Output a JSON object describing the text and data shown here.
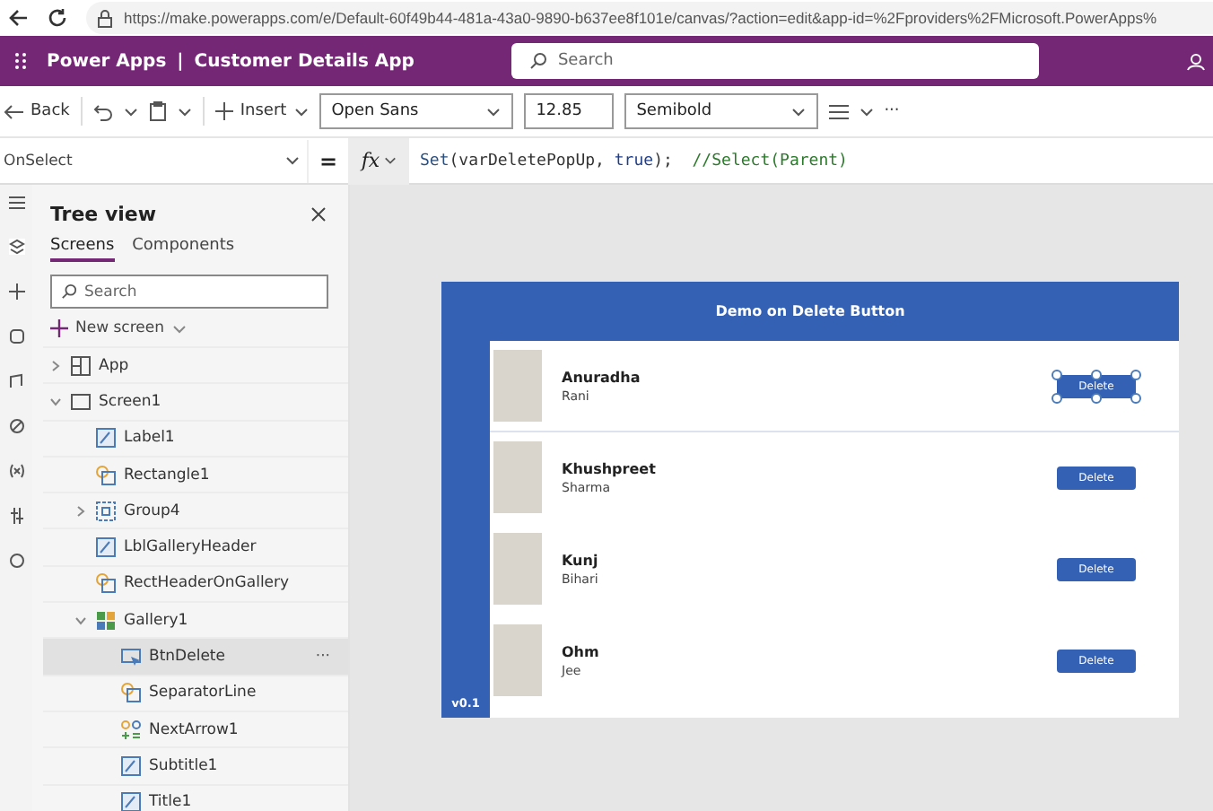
{
  "browser": {
    "url": "https://make.powerapps.com/e/Default-60f49b44-481a-43a0-9890-b637ee8f101e/canvas/?action=edit&app-id=%2Fproviders%2FMicrosoft.PowerApps%"
  },
  "header": {
    "product": "Power Apps",
    "separator": "|",
    "app_name": "Customer Details App",
    "search_placeholder": "Search"
  },
  "toolbar": {
    "back": "Back",
    "insert": "Insert",
    "font": "Open Sans",
    "font_size": "12.85",
    "font_weight": "Semibold",
    "more": "···"
  },
  "formula_bar": {
    "property": "OnSelect",
    "equals": "=",
    "fx": "fx",
    "code": [
      {
        "text": "Set",
        "kind": "fn"
      },
      {
        "text": "(varDeletePopUp, ",
        "kind": "plain"
      },
      {
        "text": "true",
        "kind": "keyword"
      },
      {
        "text": ");  ",
        "kind": "plain"
      },
      {
        "text": "//Select(Parent)",
        "kind": "comment"
      }
    ]
  },
  "tree_view": {
    "title": "Tree view",
    "tabs": [
      {
        "label": "Screens",
        "selected": true
      },
      {
        "label": "Components",
        "selected": false
      }
    ],
    "search_placeholder": "Search",
    "new_screen": "New screen",
    "items": [
      {
        "label": "App",
        "kind": "app",
        "expanded": false,
        "selected": false
      },
      {
        "label": "Screen1",
        "kind": "screen",
        "expanded": true,
        "selected": false,
        "children": [
          {
            "label": "Label1",
            "kind": "label",
            "selected": false
          },
          {
            "label": "Rectangle1",
            "kind": "shape",
            "selected": false
          },
          {
            "label": "Group4",
            "kind": "group",
            "expanded": false,
            "selected": false
          },
          {
            "label": "LblGalleryHeader",
            "kind": "label",
            "selected": false
          },
          {
            "label": "RectHeaderOnGallery",
            "kind": "shape",
            "selected": false
          },
          {
            "label": "Gallery1",
            "kind": "gallery",
            "expanded": true,
            "selected": false,
            "children": [
              {
                "label": "BtnDelete",
                "kind": "button",
                "selected": true,
                "more": "···"
              },
              {
                "label": "SeparatorLine",
                "kind": "shape",
                "selected": false
              },
              {
                "label": "NextArrow1",
                "kind": "icon",
                "selected": false
              },
              {
                "label": "Subtitle1",
                "kind": "label",
                "selected": false
              },
              {
                "label": "Title1",
                "kind": "label",
                "selected": false
              }
            ]
          }
        ]
      }
    ]
  },
  "app": {
    "title": "Demo on Delete Button",
    "version": "v0.1",
    "rows": [
      {
        "name": "Anuradha",
        "surname": "Rani",
        "button": "Delete",
        "selected": true
      },
      {
        "name": "Khushpreet",
        "surname": "Sharma",
        "button": "Delete",
        "selected": false
      },
      {
        "name": "Kunj",
        "surname": "Bihari",
        "button": "Delete",
        "selected": false
      },
      {
        "name": "Ohm",
        "surname": "Jee",
        "button": "Delete",
        "selected": false
      }
    ]
  }
}
